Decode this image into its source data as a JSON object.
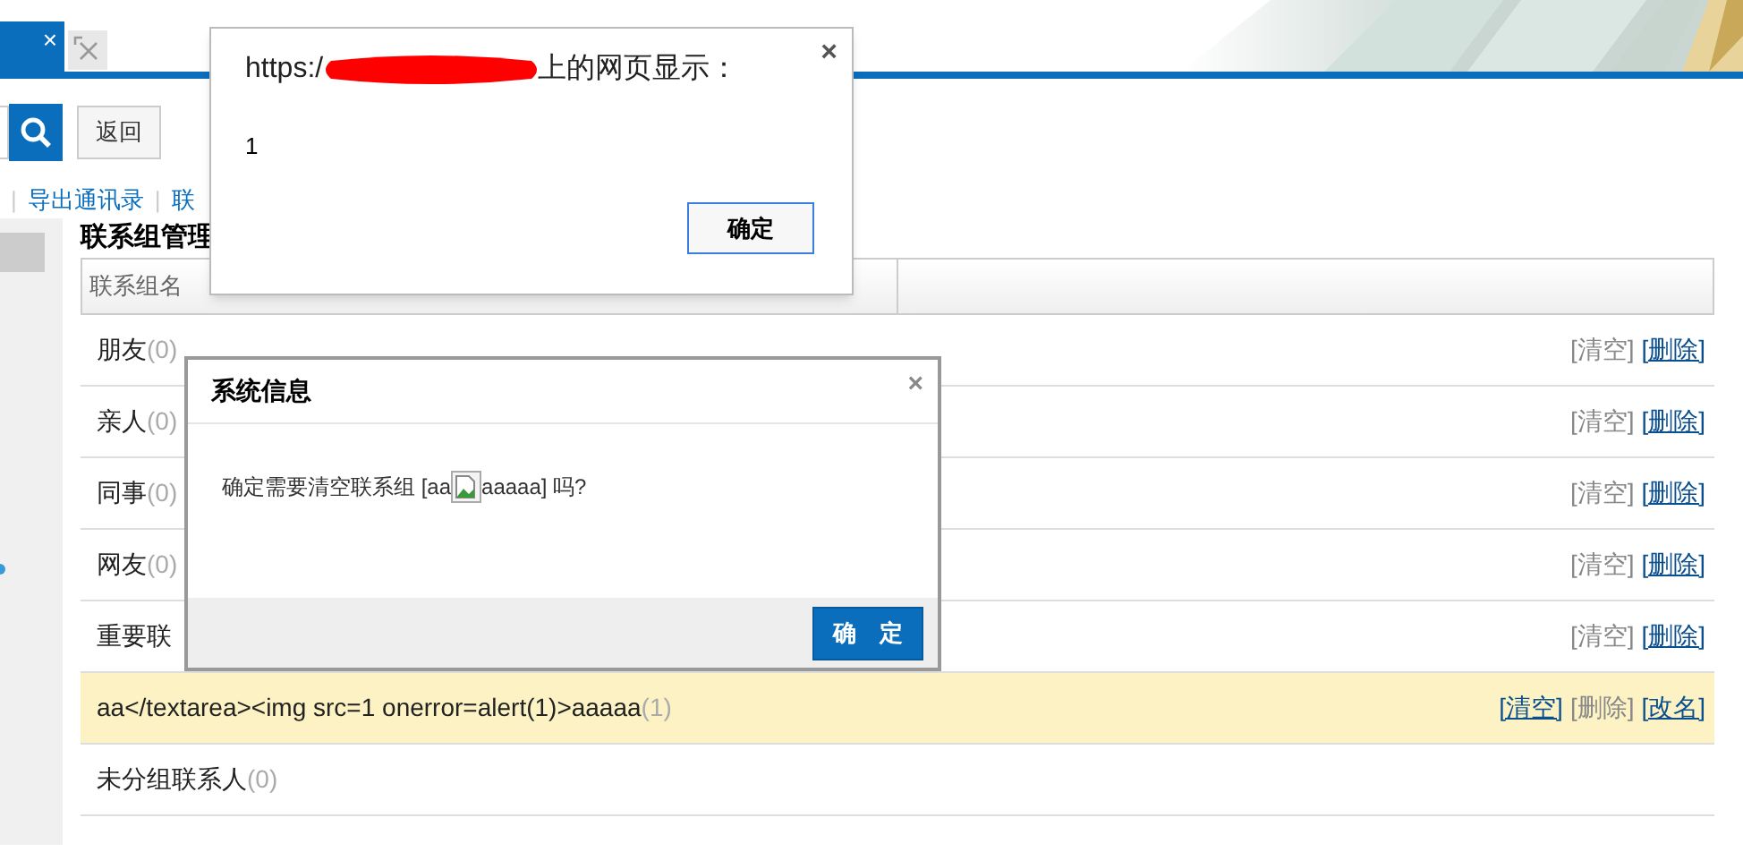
{
  "tab": {
    "close": "×",
    "selected": true
  },
  "toolbar": {
    "back_button": "返回"
  },
  "links": [
    {
      "separator": "|",
      "label": "导出通讯录"
    },
    {
      "separator": "|",
      "label": "联"
    }
  ],
  "page_title": "联系组管理",
  "table": {
    "columns": [
      "联系组名"
    ],
    "rows": [
      {
        "name": "朋友",
        "count": "(0)",
        "selected": false,
        "actions": [
          {
            "label": "[清空]",
            "disabled": true
          },
          {
            "label": "[删除]",
            "disabled": false
          }
        ]
      },
      {
        "name": "亲人",
        "count": "(0)",
        "selected": false,
        "actions": [
          {
            "label": "[清空]",
            "disabled": true
          },
          {
            "label": "[删除]",
            "disabled": false
          }
        ]
      },
      {
        "name": "同事",
        "count": "(0)",
        "selected": false,
        "actions": [
          {
            "label": "[清空]",
            "disabled": true
          },
          {
            "label": "[删除]",
            "disabled": false
          }
        ]
      },
      {
        "name": "网友",
        "count": "(0)",
        "selected": false,
        "actions": [
          {
            "label": "[清空]",
            "disabled": true
          },
          {
            "label": "[删除]",
            "disabled": false
          }
        ]
      },
      {
        "name": "重要联",
        "selected": false,
        "actions": [
          {
            "label": "[清空]",
            "disabled": true
          },
          {
            "label": "[删除]",
            "disabled": false
          }
        ]
      },
      {
        "name": "aa</textarea><img src=1 onerror=alert(1)>aaaaa",
        "count": "(1)",
        "selected": true,
        "actions": [
          {
            "label": "[清空]",
            "disabled": false
          },
          {
            "label": "[删除]",
            "disabled": true
          },
          {
            "label": "[改名]",
            "disabled": false
          }
        ]
      },
      {
        "name": "未分组联系人",
        "count": "(0)",
        "selected": false
      }
    ]
  },
  "alert": {
    "title_prefix": "https:/",
    "title_suffix": "上的网页显示：",
    "close": "×",
    "message": "1",
    "ok_button": "确定"
  },
  "confirm": {
    "title": "系统信息",
    "close": "×",
    "message_before": "确定需要清空联系组 [aa",
    "message_after": "aaaaa] 吗?",
    "ok_button": "确　定"
  }
}
